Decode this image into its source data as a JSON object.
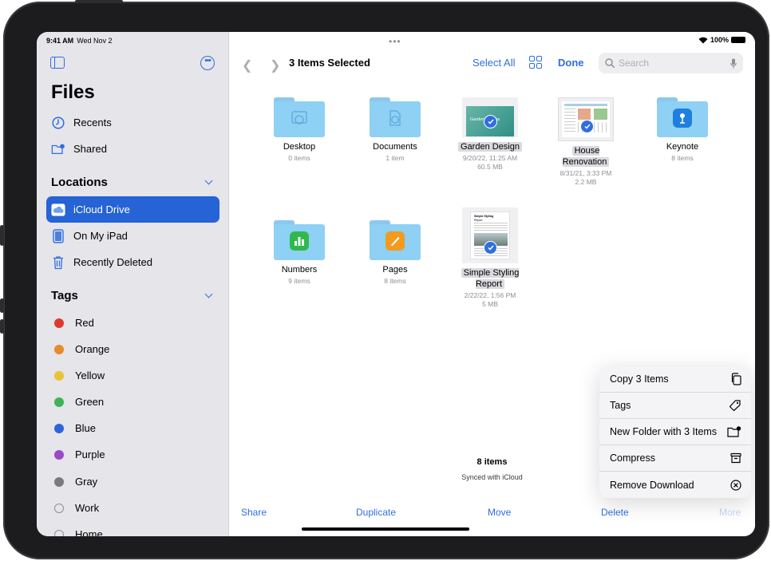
{
  "status": {
    "time": "9:41 AM",
    "date": "Wed Nov 2",
    "battery": "100%",
    "multitask": "•••"
  },
  "sidebar": {
    "title": "Files",
    "top_items": [
      {
        "label": "Recents",
        "icon": "clock-icon"
      },
      {
        "label": "Shared",
        "icon": "shared-folder-icon"
      }
    ],
    "locations": {
      "heading": "Locations",
      "items": [
        {
          "label": "iCloud Drive",
          "icon": "cloud-icon",
          "active": true
        },
        {
          "label": "On My iPad",
          "icon": "ipad-icon"
        },
        {
          "label": "Recently Deleted",
          "icon": "trash-icon"
        }
      ]
    },
    "tags": {
      "heading": "Tags",
      "items": [
        {
          "label": "Red",
          "color": "#e0382f"
        },
        {
          "label": "Orange",
          "color": "#e8892b"
        },
        {
          "label": "Yellow",
          "color": "#e8c334"
        },
        {
          "label": "Green",
          "color": "#3cb456"
        },
        {
          "label": "Blue",
          "color": "#2f63d8"
        },
        {
          "label": "Purple",
          "color": "#9a48c6"
        },
        {
          "label": "Gray",
          "color": "#7a7a7e"
        },
        {
          "label": "Work",
          "color": ""
        },
        {
          "label": "Home",
          "color": ""
        }
      ]
    }
  },
  "toolbar": {
    "title": "3 Items Selected",
    "select_all": "Select All",
    "done": "Done",
    "search_placeholder": "Search"
  },
  "files": [
    {
      "name": "Desktop",
      "meta": [
        "0 items"
      ]
    },
    {
      "name": "Documents",
      "meta": [
        "1 item"
      ]
    },
    {
      "name": "Garden Design",
      "meta": [
        "9/20/22, 11:25 AM",
        "60.5 MB"
      ],
      "selected": true
    },
    {
      "name": "House\nRenovation",
      "meta": [
        "8/31/21, 3:33 PM",
        "2.2 MB"
      ],
      "selected": true
    },
    {
      "name": "Keynote",
      "meta": [
        "8 items"
      ]
    },
    {
      "name": "Numbers",
      "meta": [
        "9 items"
      ]
    },
    {
      "name": "Pages",
      "meta": [
        "8 items"
      ]
    },
    {
      "name": "Simple Styling\nReport",
      "meta": [
        "2/22/22, 1:56 PM",
        "5 MB"
      ],
      "selected": true
    }
  ],
  "thumb_text": {
    "garden": "Garden Rooms",
    "report_title": "Simple Styling",
    "report_sub": "Report"
  },
  "footer": {
    "count": "8 items",
    "sync": "Synced with iCloud"
  },
  "bottom_bar": {
    "share": "Share",
    "duplicate": "Duplicate",
    "move": "Move",
    "delete": "Delete",
    "more": "More"
  },
  "context_menu": [
    {
      "label": "Copy 3 Items",
      "icon": "copy-icon"
    },
    {
      "label": "Tags",
      "icon": "tag-icon"
    },
    {
      "label": "New Folder with 3 Items",
      "icon": "new-folder-icon"
    },
    {
      "label": "Compress",
      "icon": "archive-icon"
    },
    {
      "label": "Remove Download",
      "icon": "remove-circle-icon"
    }
  ],
  "colors": {
    "accent": "#2f6ee0",
    "folder": "#8fd0f5",
    "sidebar": "#e5e5ea",
    "selection": "#2563d6"
  }
}
